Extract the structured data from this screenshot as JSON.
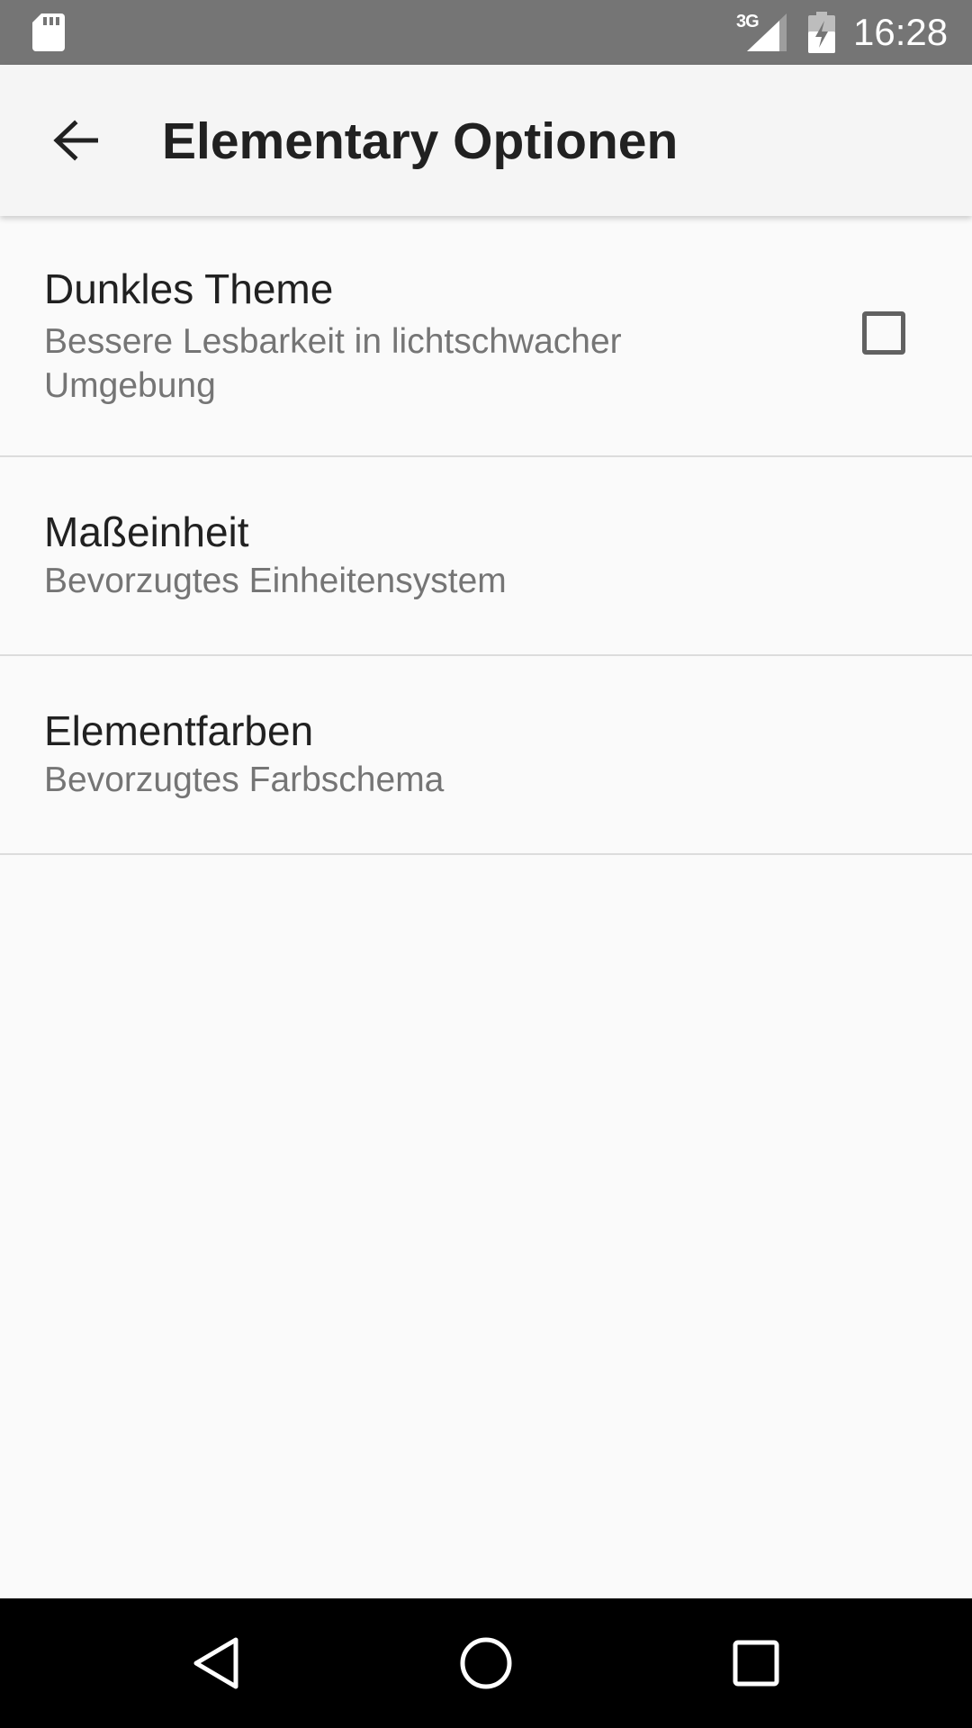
{
  "status_bar": {
    "time": "16:28",
    "network_type": "3G",
    "icons": [
      "sd-card-icon",
      "signal-icon",
      "battery-charging-icon"
    ]
  },
  "app_bar": {
    "title": "Elementary Optionen",
    "back_icon": "arrow-back-icon"
  },
  "preferences": [
    {
      "title": "Dunkles Theme",
      "summary": "Bessere Lesbarkeit in lichtschwacher Umgebung",
      "widget": "checkbox",
      "checked": false
    },
    {
      "title": "Maßeinheit",
      "summary": "Bevorzugtes Einheitensystem"
    },
    {
      "title": "Elementfarben",
      "summary": "Bevorzugtes Farbschema"
    }
  ],
  "nav_bar": {
    "icons": [
      "nav-back-icon",
      "nav-home-icon",
      "nav-recents-icon"
    ]
  },
  "colors": {
    "status_bar": "#757575",
    "app_bar": "#f5f5f5",
    "background": "#fafafa",
    "title_text": "#212121",
    "summary_text": "#757575",
    "divider": "#dcdcdc",
    "nav_bar": "#000000"
  }
}
